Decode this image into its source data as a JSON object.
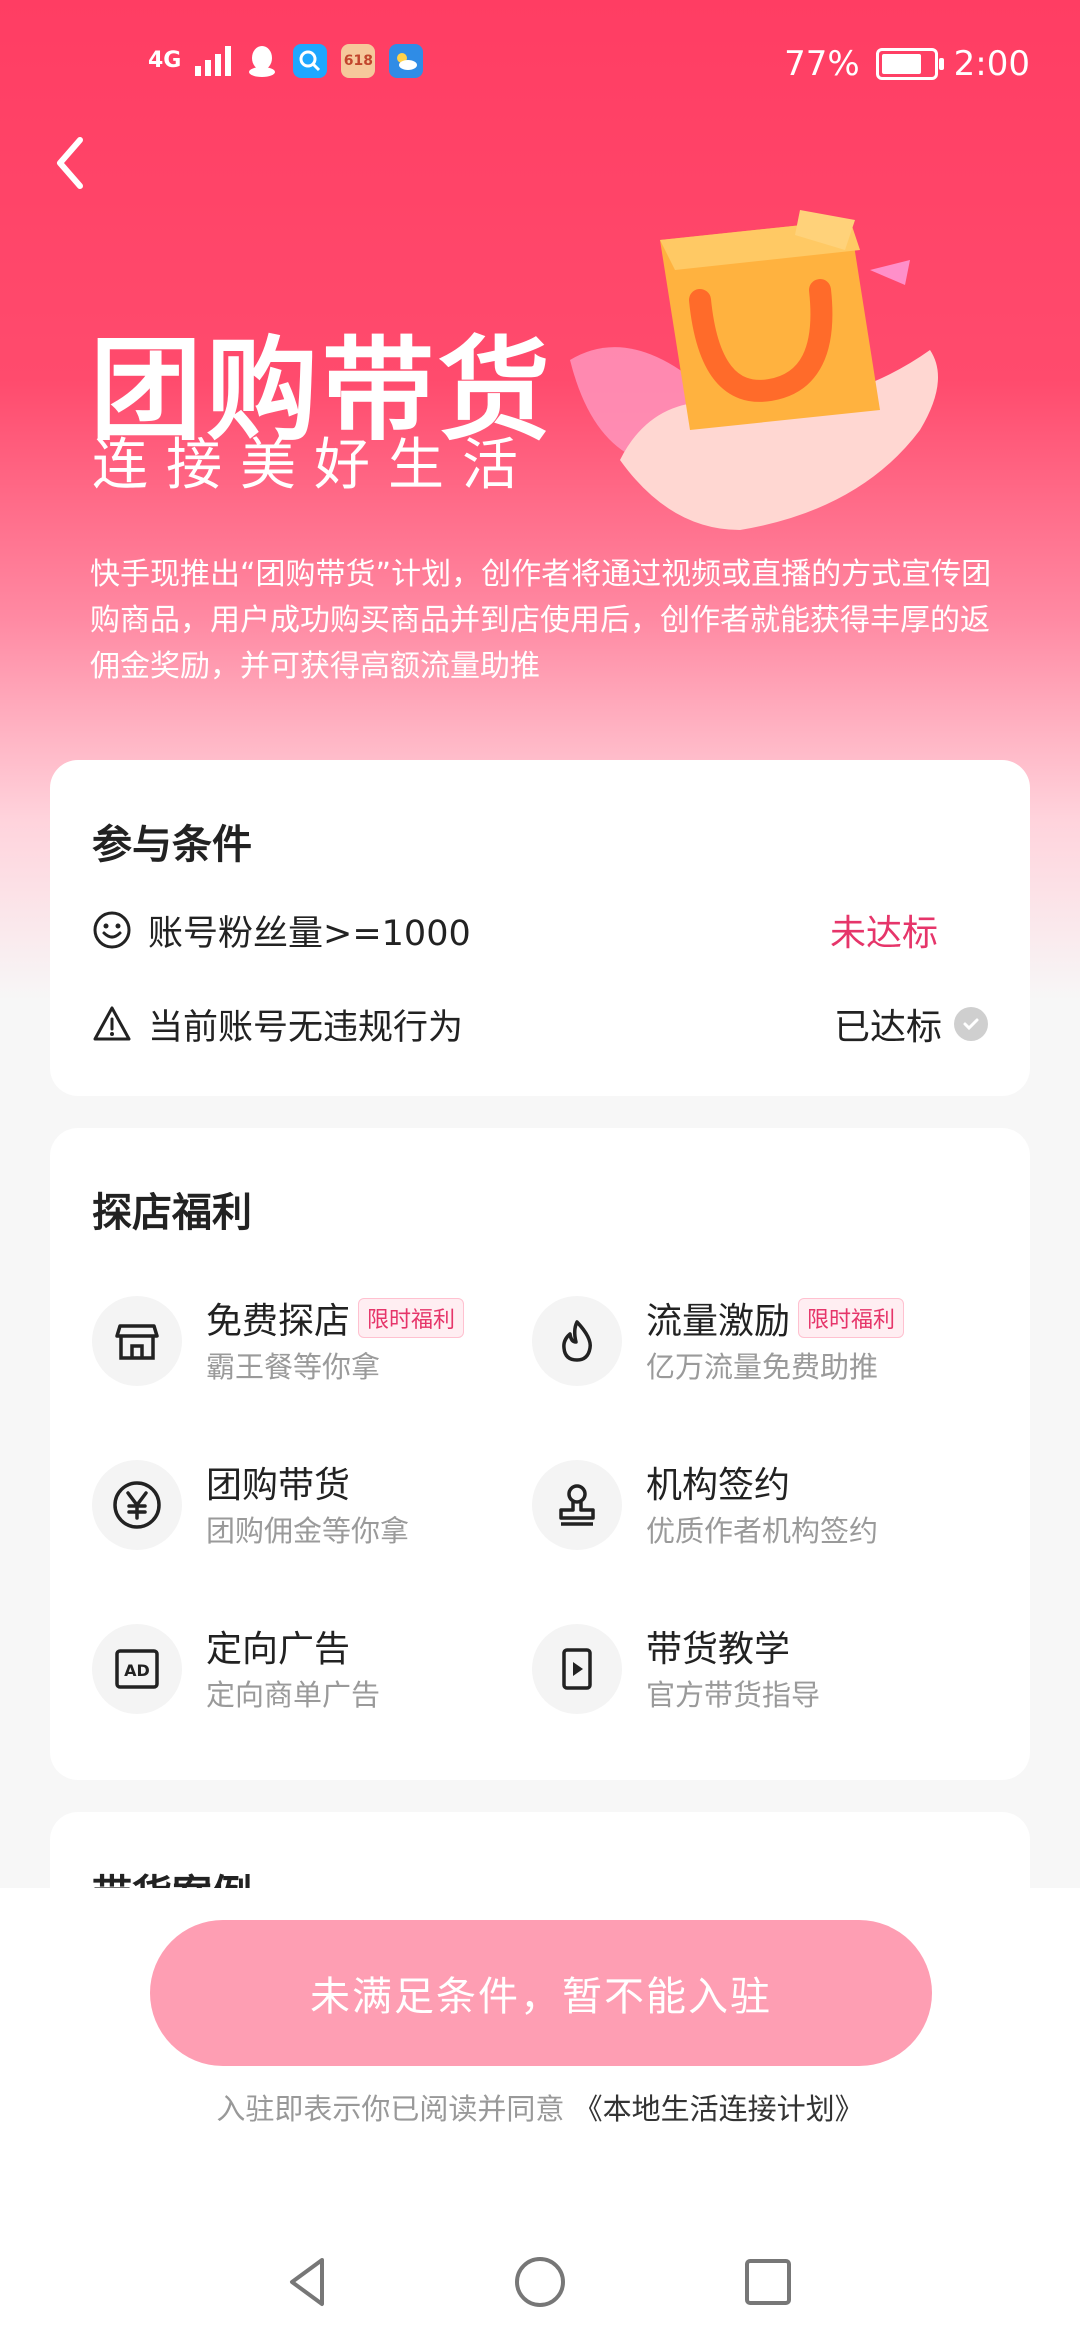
{
  "status_bar": {
    "network": "4G",
    "battery": "77%",
    "time": "2:00",
    "apps": [
      "qq-icon",
      "search-app-icon",
      "618-app-icon",
      "weather-app-icon"
    ],
    "battery_level": 0.77
  },
  "hero": {
    "title": "团购带货",
    "subtitle": "连接美好生活",
    "description": "快手现推出“团购带货”计划，创作者将通过视频或直播的方式宣传团购商品，用户成功购买商品并到店使用后，创作者就能获得丰厚的返佣金奖励，并可获得高额流量助推"
  },
  "conditions": {
    "title": "参与条件",
    "items": [
      {
        "label": "账号粉丝量>=1000",
        "status": "未达标",
        "icon": "smiley-icon"
      },
      {
        "label": "当前账号无违规行为",
        "status": "已达标",
        "icon": "warning-icon"
      }
    ]
  },
  "benefits": {
    "title": "探店福利",
    "items": [
      {
        "name": "免费探店",
        "tag": "限时福利",
        "desc": "霸王餐等你拿",
        "icon": "store-icon"
      },
      {
        "name": "流量激励",
        "tag": "限时福利",
        "desc": "亿万流量免费助推",
        "icon": "flame-icon"
      },
      {
        "name": "团购带货",
        "tag": "",
        "desc": "团购佣金等你拿",
        "icon": "yen-icon"
      },
      {
        "name": "机构签约",
        "tag": "",
        "desc": "优质作者机构签约",
        "icon": "stamp-icon"
      },
      {
        "name": "定向广告",
        "tag": "",
        "desc": "定向商单广告",
        "icon": "ad-icon"
      },
      {
        "name": "带货教学",
        "tag": "",
        "desc": "官方带货指导",
        "icon": "video-icon"
      }
    ]
  },
  "cases": {
    "title": "带货案例"
  },
  "footer": {
    "button": "未满足条件，暂不能入驻",
    "agreement_prefix": "入驻即表示你已阅读并同意",
    "agreement_link": "《本地生活连接计划》"
  },
  "colors": {
    "primary": "#ff3d63",
    "not_met": "#e6356a",
    "button_disabled": "#fe9eb3"
  }
}
